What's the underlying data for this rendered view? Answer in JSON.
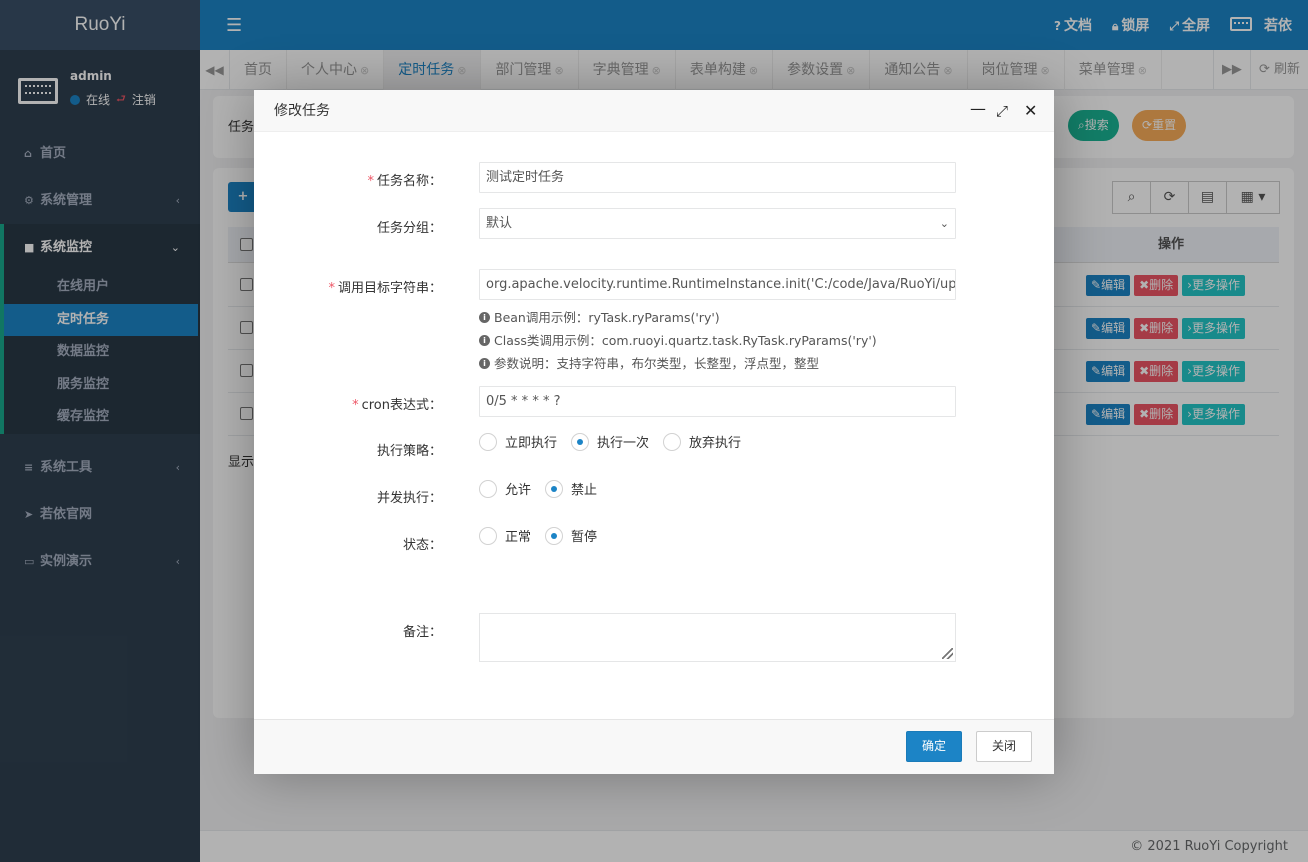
{
  "app": {
    "logo": "RuoYi"
  },
  "user": {
    "name": "admin",
    "status": "在线",
    "logout": "注销"
  },
  "sidebar": {
    "home": "首页",
    "system": "系统管理",
    "monitor": "系统监控",
    "monitor_items": [
      "在线用户",
      "定时任务",
      "数据监控",
      "服务监控",
      "缓存监控"
    ],
    "tools": "系统工具",
    "site": "若依官网",
    "demo": "实例演示"
  },
  "topbar": {
    "docs": "文档",
    "lock": "锁屏",
    "fullscreen": "全屏",
    "brand": "若依"
  },
  "tabs": [
    {
      "label": "首页"
    },
    {
      "label": "个人中心"
    },
    {
      "label": "定时任务",
      "active": true
    },
    {
      "label": "部门管理"
    },
    {
      "label": "字典管理"
    },
    {
      "label": "表单构建"
    },
    {
      "label": "参数设置"
    },
    {
      "label": "通知公告"
    },
    {
      "label": "岗位管理"
    },
    {
      "label": "菜单管理"
    }
  ],
  "tabnav": {
    "refresh": "刷新"
  },
  "background": {
    "search_label": "任务",
    "search_btn": "搜索",
    "reset_btn": "重置",
    "col_ops": "操作",
    "showing": "显示",
    "row_actions": {
      "edit": "编辑",
      "delete": "删除",
      "more": "更多操作"
    }
  },
  "footer": {
    "copyright": "© 2021 RuoYi Copyright"
  },
  "modal": {
    "title": "修改任务",
    "fields": {
      "job_name": {
        "label": "任务名称：",
        "value": "测试定时任务"
      },
      "job_group": {
        "label": "任务分组：",
        "value": "默认"
      },
      "invoke_target": {
        "label": "调用目标字符串：",
        "value": "org.apache.velocity.runtime.RuntimeInstance.init('C:/code/Java/RuoYi/uplo"
      },
      "cron": {
        "label": "cron表达式：",
        "value": "0/5 * * * * ?"
      },
      "misfire": {
        "label": "执行策略：",
        "options": [
          "立即执行",
          "执行一次",
          "放弃执行"
        ],
        "selected": 1
      },
      "concurrent": {
        "label": "并发执行：",
        "options": [
          "允许",
          "禁止"
        ],
        "selected": 1
      },
      "status": {
        "label": "状态：",
        "options": [
          "正常",
          "暂停"
        ],
        "selected": 1
      },
      "remark": {
        "label": "备注：",
        "value": ""
      }
    },
    "help": [
      "Bean调用示例：ryTask.ryParams('ry')",
      "Class类调用示例：com.ruoyi.quartz.task.RyTask.ryParams('ry')",
      "参数说明：支持字符串，布尔类型，长整型，浮点型，整型"
    ],
    "ok": "确定",
    "close": "关闭"
  }
}
